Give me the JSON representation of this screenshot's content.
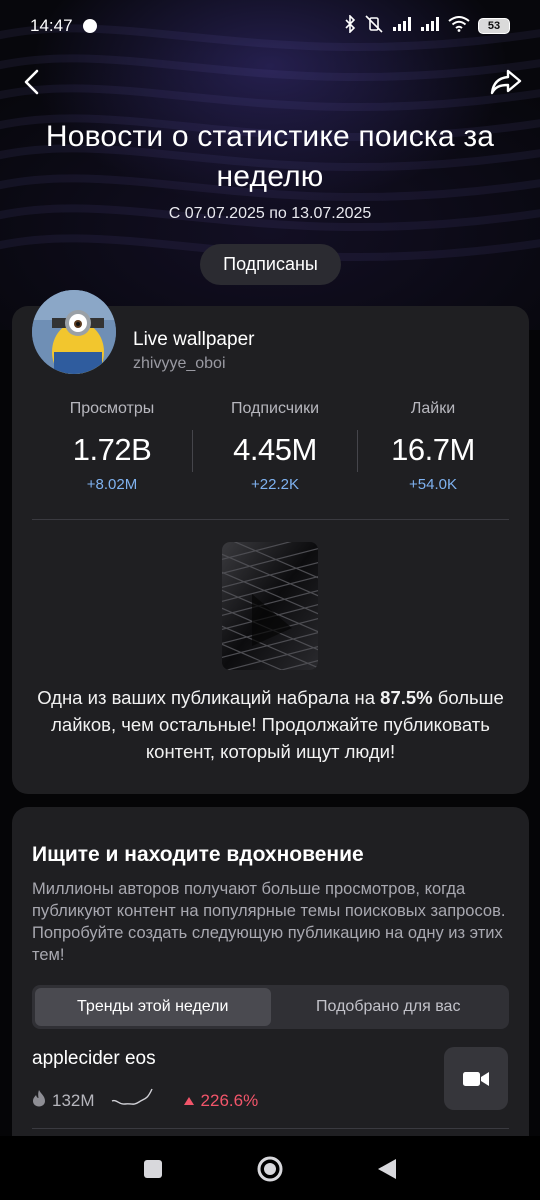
{
  "status_bar": {
    "time": "14:47",
    "battery": "53",
    "icons": [
      "bluetooth-icon",
      "vibrate-off-icon",
      "signal-icon",
      "signal-icon",
      "wifi-icon",
      "battery-icon"
    ]
  },
  "header": {
    "back_icon": "back-arrow-icon",
    "share_icon": "share-icon",
    "title": "Новости о статистике поиска за неделю",
    "date_range": "С 07.07.2025 по 13.07.2025",
    "subscribed_label": "Подписаны"
  },
  "profile": {
    "name": "Live wallpaper",
    "handle": "zhivyye_oboi",
    "stats": [
      {
        "label": "Просмотры",
        "value": "1.72B",
        "delta": "+8.02M"
      },
      {
        "label": "Подписчики",
        "value": "4.45M",
        "delta": "+22.2K"
      },
      {
        "label": "Лайки",
        "value": "16.7M",
        "delta": "+54.0K"
      }
    ],
    "highlight_before": "Одна из ваших публикаций набрала на ",
    "highlight_bold": "87.5%",
    "highlight_after": " больше лайков, чем остальные! Продолжайте публиковать контент, который ищут люди!"
  },
  "inspiration": {
    "title": "Ищите и находите вдохновение",
    "description": "Миллионы авторов получают больше просмотров, когда публикуют контент на популярные темы поисковых запросов. Попробуйте создать следующую публикацию на одну из этих тем!",
    "tabs": [
      {
        "label": "Тренды этой недели",
        "active": true
      },
      {
        "label": "Подобрано для вас",
        "active": false
      }
    ],
    "trend": {
      "title": "applecider eos",
      "views": "132M",
      "growth": "226.6%"
    }
  },
  "colors": {
    "accent_blue": "#7fb2f0",
    "growth_red": "#f2556a",
    "card_bg": "#1f1f22"
  }
}
